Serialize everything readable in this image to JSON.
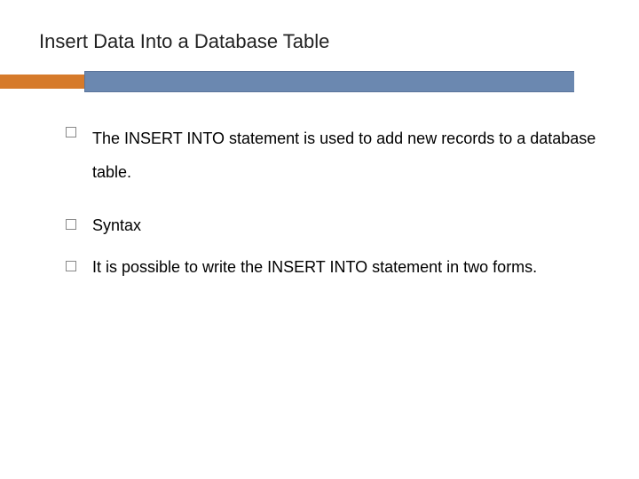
{
  "title": "Insert Data Into a Database Table",
  "bullets": [
    {
      "text": "The INSERT INTO statement is used to add new records to a database table."
    },
    {
      "text": "Syntax"
    },
    {
      "text": "It is possible to write the INSERT INTO statement in two forms."
    }
  ],
  "colors": {
    "accent_orange": "#d67a2a",
    "accent_blue": "#6b88b0"
  }
}
